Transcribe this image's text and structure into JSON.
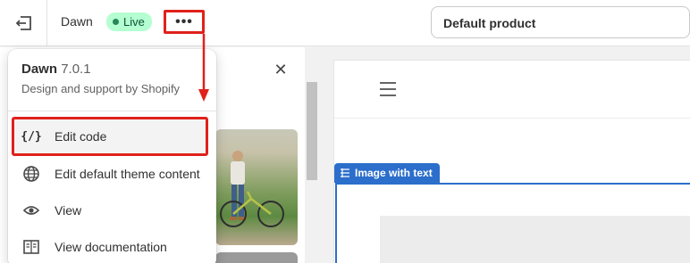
{
  "topbar": {
    "theme_name": "Dawn",
    "status_badge": "Live",
    "more_label": "•••",
    "product_select": "Default product"
  },
  "popover": {
    "theme_title": "Dawn",
    "theme_version": "7.0.1",
    "subtitle": "Design and support by Shopify",
    "items": [
      {
        "label": "Edit code",
        "icon": "code-icon",
        "icon_text": "{/}"
      },
      {
        "label": "Edit default theme content",
        "icon": "globe-icon"
      },
      {
        "label": "View",
        "icon": "eye-icon"
      },
      {
        "label": "View documentation",
        "icon": "book-icon"
      }
    ]
  },
  "panel": {
    "close_label": "✕"
  },
  "preview": {
    "section_tag": "Image with text"
  },
  "colors": {
    "highlight": "#e0211b",
    "live_badge_bg": "#b4fed2",
    "live_dot": "#29845a",
    "section_accent": "#2c6ecb"
  }
}
